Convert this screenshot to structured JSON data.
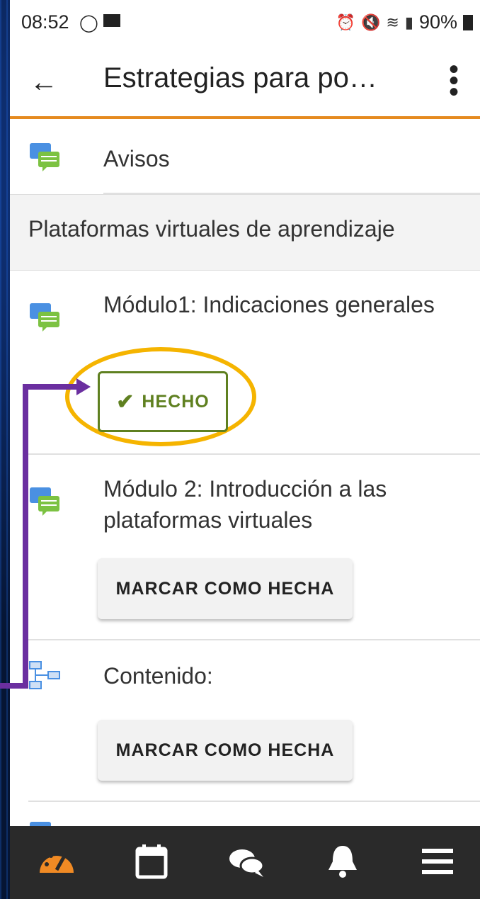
{
  "status": {
    "time": "08:52",
    "battery": "90%"
  },
  "appbar": {
    "title": "Estrategias para po…"
  },
  "items": {
    "avisos": "Avisos",
    "section": "Plataformas virtuales de aprendizaje",
    "modulo1": "Módulo1: Indicaciones generales",
    "done_label": "HECHO",
    "modulo2": "Módulo 2: Introducción a las plataformas virtuales",
    "mark_label_1": "MARCAR COMO HECHA",
    "contenido": "Contenido:",
    "mark_label_2": "MARCAR COMO HECHA"
  },
  "tabs": [
    "dashboard-icon",
    "calendar-icon",
    "messages-icon",
    "notifications-icon",
    "menu-icon"
  ],
  "colors": {
    "accent": "#e58a1f",
    "done": "#5f8020",
    "highlight": "#f5b400",
    "annotation": "#6b2fa0"
  }
}
